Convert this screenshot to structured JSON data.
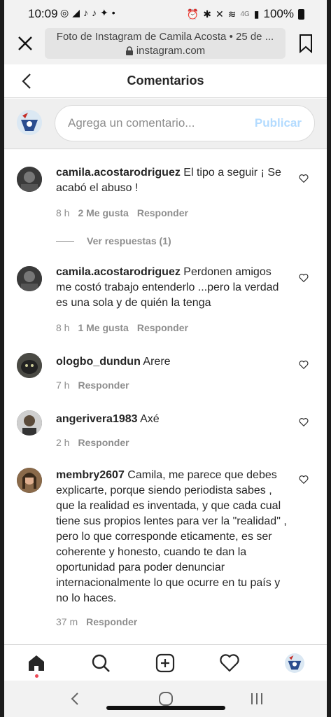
{
  "status": {
    "time": "10:09",
    "app_icons": [
      "whatsapp-icon",
      "telegram-icon",
      "tiktok-icon",
      "tiktok-icon",
      "twitter-icon",
      "dot"
    ],
    "network": "4G",
    "battery": "100%"
  },
  "browser": {
    "page_title": "Foto de Instagram de Camila Acosta • 25 de ...",
    "domain": "instagram.com"
  },
  "header": {
    "title": "Comentarios"
  },
  "composer": {
    "placeholder": "Agrega un comentario...",
    "publish_label": "Publicar"
  },
  "comments": [
    {
      "user": "camila.acostarodriguez",
      "text": "El tipo a seguir ¡ Se acabó el abuso !",
      "time": "8 h",
      "likes": "2 Me gusta",
      "reply": "Responder",
      "view_replies": "Ver respuestas (1)"
    },
    {
      "user": "camila.acostarodriguez",
      "text": "Perdonen amigos me costó trabajo entenderlo ...pero la verdad es una sola y de quién la tenga",
      "time": "8 h",
      "likes": "1 Me gusta",
      "reply": "Responder"
    },
    {
      "user": "ologbo_dundun",
      "text": "Arere",
      "time": "7 h",
      "reply": "Responder"
    },
    {
      "user": "angerivera1983",
      "text": "Axé",
      "time": "2 h",
      "reply": "Responder"
    },
    {
      "user": "membry2607",
      "text": "Camila, me parece que debes explicarte, porque siendo periodista sabes , que la realidad es inventada, y que cada cual tiene sus propios lentes para ver la \"realidad\" , pero lo que corresponde eticamente, es ser coherente y honesto, cuando te dan la oportunidad para poder denunciar internacionalmente lo que ocurre en tu país y no lo haces.",
      "time": "37 m",
      "reply": "Responder"
    }
  ],
  "colors": {
    "publish_disabled": "#b3dbff",
    "meta_gray": "#8e8e8e",
    "notification_dot": "#ed4956"
  }
}
